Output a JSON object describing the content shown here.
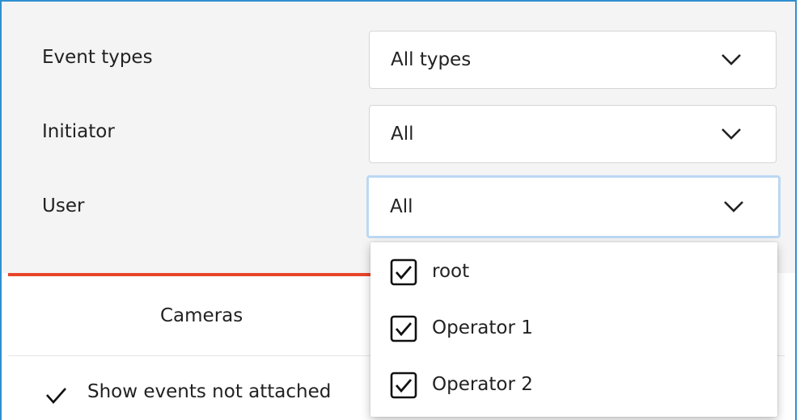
{
  "filters": {
    "event_types": {
      "label": "Event types",
      "value": "All types"
    },
    "initiator": {
      "label": "Initiator",
      "value": "All"
    },
    "user": {
      "label": "User",
      "value": "All"
    }
  },
  "tabs": {
    "active_label": "Cameras",
    "active_color": "#e8452a"
  },
  "show_events": {
    "label": "Show events not attached",
    "checked": true
  },
  "user_dropdown": {
    "options": [
      {
        "label": "root",
        "checked": true
      },
      {
        "label": "Operator 1",
        "checked": true
      },
      {
        "label": "Operator 2",
        "checked": true
      }
    ]
  },
  "icons": {
    "chevron": "chevron-down-icon",
    "checkbox": "checkbox-checked-icon"
  },
  "colors": {
    "focus_ring": "#bcd8f3",
    "window_border": "#2f8fd0",
    "panel_bg": "#f4f4f4"
  }
}
